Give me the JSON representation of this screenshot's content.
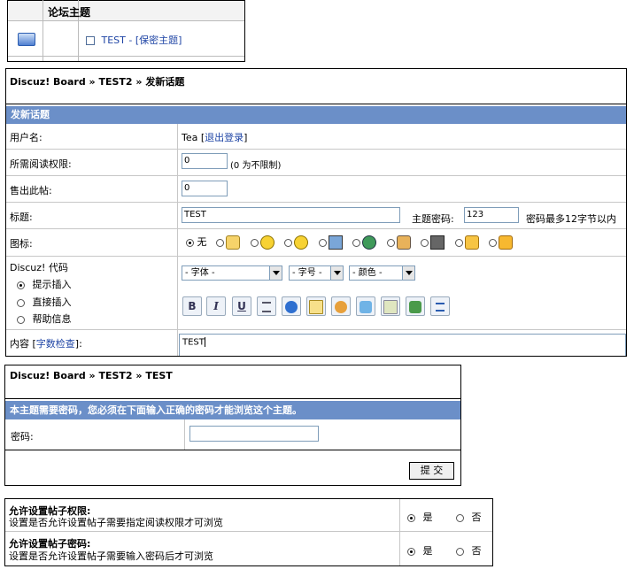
{
  "forum_list": {
    "header": "论坛主题",
    "topic_title": "TEST",
    "topic_tag": " - [保密主题]"
  },
  "new_topic": {
    "breadcrumb": "Discuz! Board » TEST2 » 发新话题",
    "section_title": "发新话题",
    "username_label": "用户名:",
    "username_value": "Tea",
    "logout_bracket_open": " [",
    "logout_link": "退出登录",
    "logout_bracket_close": "]",
    "read_perm_label": "所需阅读权限:",
    "read_perm_value": "0",
    "read_perm_hint": "(0 为不限制)",
    "sell_label": "售出此帖:",
    "sell_value": "0",
    "title_label": "标题:",
    "title_value": "TEST",
    "topic_password_label": "主题密码:",
    "topic_password_value": "123",
    "password_hint": "密码最多12字节以内",
    "icon_label": "图标:",
    "icon_none": "无",
    "discuz_code_label": "Discuz! 代码",
    "code_modes": [
      "提示插入",
      "直接插入",
      "帮助信息"
    ],
    "font_select": "- 字体 -",
    "size_select": "- 字号 -",
    "color_select": "- 颜色 -",
    "toolbar_buttons": [
      "B",
      "I",
      "U"
    ],
    "content_label": "内容 [",
    "content_link": "字数检查",
    "content_label_end": "]:",
    "content_value": "TEST"
  },
  "password_page": {
    "breadcrumb": "Discuz! Board » TEST2 » TEST",
    "notice": "本主题需要密码，您必须在下面输入正确的密码才能浏览这个主题。",
    "password_label": "密码:",
    "submit_label": "提 交"
  },
  "settings": {
    "rows": [
      {
        "title": "允许设置帖子权限:",
        "desc": "设置是否允许设置帖子需要指定阅读权限才可浏览",
        "yes": "是",
        "no": "否"
      },
      {
        "title": "允许设置帖子密码:",
        "desc": "设置是否允许设置帖子需要输入密码后才可浏览",
        "yes": "是",
        "no": "否"
      }
    ]
  }
}
